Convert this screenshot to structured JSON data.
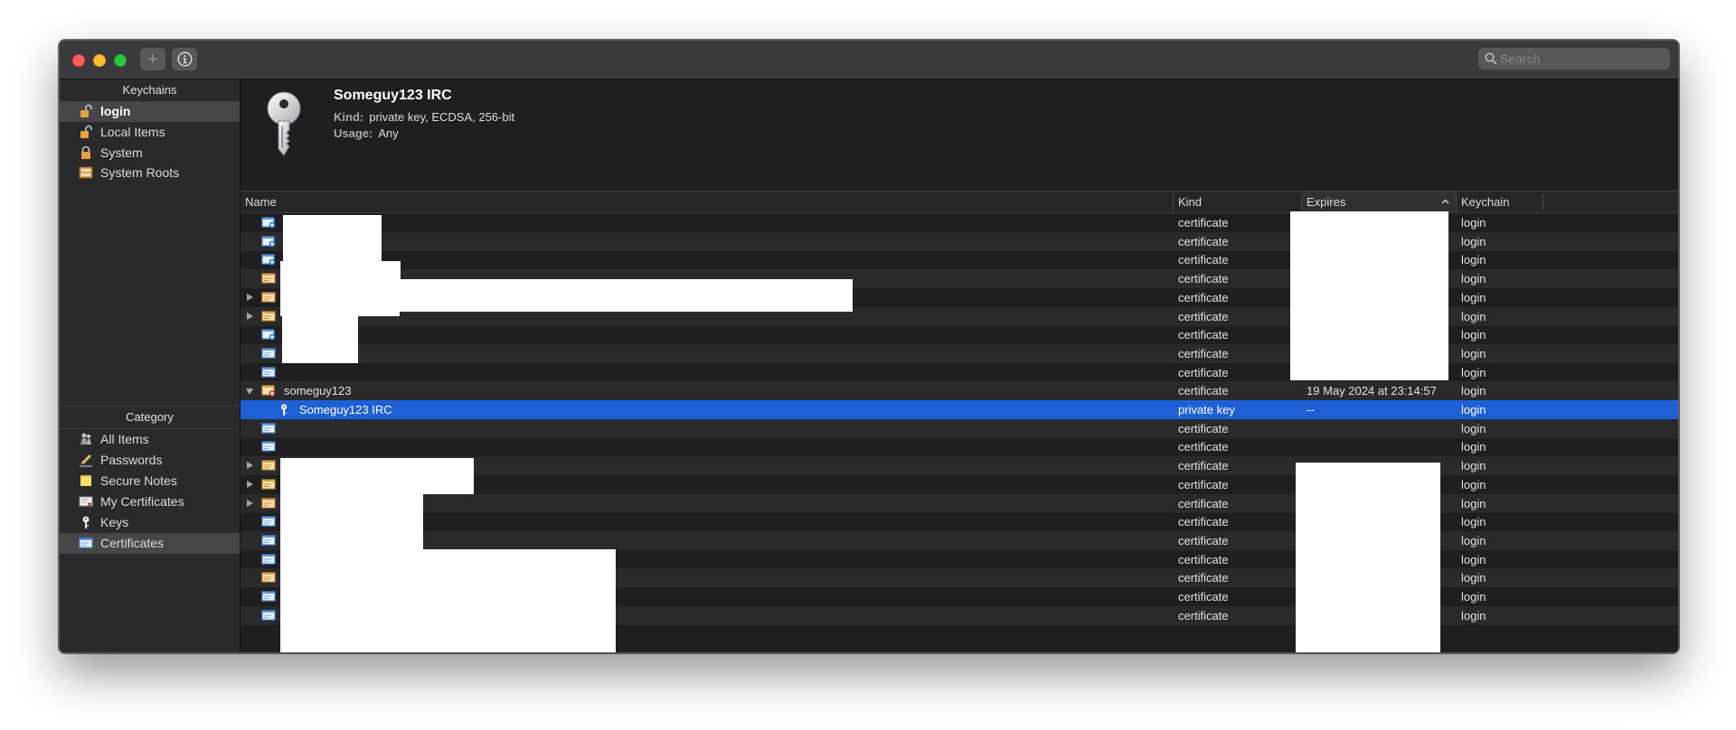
{
  "toolbar": {
    "add_glyph": "+",
    "search_placeholder": "Search"
  },
  "sidebar": {
    "keychains_header": "Keychains",
    "keychains": [
      {
        "label": "login",
        "icon": "unlocked-padlock-icon",
        "selected": true
      },
      {
        "label": "Local Items",
        "icon": "unlocked-padlock-icon"
      },
      {
        "label": "System",
        "icon": "locked-padlock-icon"
      },
      {
        "label": "System Roots",
        "icon": "cabinet-icon"
      }
    ],
    "category_header": "Category",
    "categories": [
      {
        "label": "All Items",
        "icon": "people-icon"
      },
      {
        "label": "Passwords",
        "icon": "pencil-icon"
      },
      {
        "label": "Secure Notes",
        "icon": "note-icon"
      },
      {
        "label": "My Certificates",
        "icon": "certificate-icon"
      },
      {
        "label": "Keys",
        "icon": "key-icon"
      },
      {
        "label": "Certificates",
        "icon": "certificate-blue-icon",
        "selected": true
      }
    ]
  },
  "detail": {
    "title": "Someguy123 IRC",
    "kind_label": "Kind:",
    "kind_value": "private key, ECDSA, 256-bit",
    "usage_label": "Usage:",
    "usage_value": "Any",
    "icon": "key-icon"
  },
  "table": {
    "columns": [
      "Name",
      "Kind",
      "Expires",
      "Keychain"
    ],
    "sort_column": "Expires",
    "rows": [
      {
        "name": "",
        "kind": "certificate",
        "expires": "",
        "keychain": "login",
        "icon": "cert-plus-icon"
      },
      {
        "name": "",
        "kind": "certificate",
        "expires": "",
        "keychain": "login",
        "icon": "cert-plus-icon"
      },
      {
        "name": "",
        "kind": "certificate",
        "expires": "",
        "keychain": "login",
        "icon": "cert-plus-icon"
      },
      {
        "name": "",
        "kind": "certificate",
        "expires": "",
        "keychain": "login",
        "icon": "cert-gold-icon"
      },
      {
        "name": "",
        "kind": "certificate",
        "expires": "",
        "keychain": "login",
        "icon": "cert-gold-icon",
        "disclosure": "closed"
      },
      {
        "name": "",
        "kind": "certificate",
        "expires": "",
        "keychain": "login",
        "icon": "cert-gold-icon",
        "disclosure": "closed"
      },
      {
        "name": "",
        "kind": "certificate",
        "expires": "",
        "keychain": "login",
        "icon": "cert-plus-icon"
      },
      {
        "name": "",
        "kind": "certificate",
        "expires": "",
        "keychain": "login",
        "icon": "cert-blue-icon"
      },
      {
        "name": "",
        "kind": "certificate",
        "expires": "",
        "keychain": "login",
        "icon": "cert-blue-icon"
      },
      {
        "name": "someguy123",
        "kind": "certificate",
        "expires": "19 May 2024 at 23:14:57",
        "keychain": "login",
        "icon": "cert-invalid-icon",
        "disclosure": "open"
      },
      {
        "name": "Someguy123 IRC",
        "kind": "private key",
        "expires": "--",
        "keychain": "login",
        "icon": "key-icon",
        "selected": true,
        "child": true
      },
      {
        "name": "",
        "kind": "certificate",
        "expires": "",
        "keychain": "login",
        "icon": "cert-blue-icon"
      },
      {
        "name": "",
        "kind": "certificate",
        "expires": "",
        "keychain": "login",
        "icon": "cert-blue-icon"
      },
      {
        "name": "",
        "kind": "certificate",
        "expires": "",
        "keychain": "login",
        "icon": "cert-gold-icon",
        "disclosure": "closed"
      },
      {
        "name": "",
        "kind": "certificate",
        "expires": "",
        "keychain": "login",
        "icon": "cert-gold-icon",
        "disclosure": "closed"
      },
      {
        "name": "",
        "kind": "certificate",
        "expires": "",
        "keychain": "login",
        "icon": "cert-gold-icon",
        "disclosure": "closed"
      },
      {
        "name": "",
        "kind": "certificate",
        "expires": "",
        "keychain": "login",
        "icon": "cert-blue-icon"
      },
      {
        "name": "",
        "kind": "certificate",
        "expires": "",
        "keychain": "login",
        "icon": "cert-blue-icon"
      },
      {
        "name": "",
        "kind": "certificate",
        "expires": "",
        "keychain": "login",
        "icon": "cert-blue-icon"
      },
      {
        "name": "",
        "kind": "certificate",
        "expires": "",
        "keychain": "login",
        "icon": "cert-gold-icon"
      },
      {
        "name": "",
        "kind": "certificate",
        "expires": "",
        "keychain": "login",
        "icon": "cert-blue-icon"
      },
      {
        "name": "",
        "kind": "certificate",
        "expires": "",
        "keychain": "login",
        "icon": "cert-blue-icon"
      }
    ]
  },
  "colors": {
    "selection": "#1f5fd6",
    "window_bg": "#1f1f21",
    "sidebar_bg": "#2a2a2c"
  }
}
